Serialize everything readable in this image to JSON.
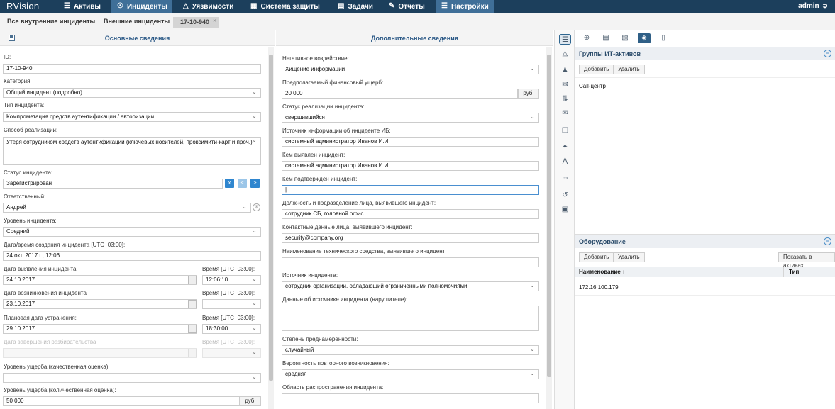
{
  "app": {
    "logo": "RVision",
    "nav": [
      "Активы",
      "Инциденты",
      "Уязвимости",
      "Система защиты",
      "Задачи",
      "Отчеты",
      "Настройки"
    ],
    "user": "admin"
  },
  "tabs": {
    "internal": "Все внутренние инциденты",
    "external": "Внешние инциденты",
    "current": "17-10-940",
    "close": "×"
  },
  "left": {
    "title": "Основные сведения",
    "id_label": "ID:",
    "id_value": "17-10-940",
    "category_label": "Категория:",
    "category_value": "Общий инцидент (подробно)",
    "type_label": "Тип инцидента:",
    "type_value": "Компрометация средств аутентификации / авторизации",
    "method_label": "Способ реализации:",
    "method_value": "Утеря сотрудником средств аутентификации (ключевых носителей, проксимити-карт и проч.)",
    "status_label": "Статус инцидента:",
    "status_value": "Зарегистрирован",
    "status_btn_x": "x",
    "status_btn_prev": "<",
    "status_btn_next": ">",
    "responsible_label": "Ответственный:",
    "responsible_value": "Андрей",
    "clear_symbol": "⊗",
    "level_label": "Уровень инцидента:",
    "level_value": "Средний",
    "created_label": "Дата/время создания инцидента [UTC+03:00]:",
    "created_value": "24 окт. 2017 г., 12:06",
    "detected_label": "Дата выявления инцидента",
    "detected_date": "24.10.2017",
    "time_label": "Время [UTC+03:00]:",
    "detected_time": "12:06:10",
    "occurred_label": "Дата возникновения инцидента",
    "occurred_date": "23.10.2017",
    "occurred_time": "",
    "planned_label": "Плановая дата устранения:",
    "planned_date": "29.10.2017",
    "planned_time": "18:30:00",
    "finished_label": "Дата завершения разбирательства",
    "damage_q_label": "Уровень ущерба (качественная оценка):",
    "damage_q_value": "",
    "damage_n_label": "Уровень ущерба (количественная оценка):",
    "damage_n_value": "50 000",
    "currency": "руб."
  },
  "mid": {
    "title": "Дополнительные сведения",
    "impact_label": "Негативное воздействие:",
    "impact_value": "Хищение информации",
    "loss_label": "Предполагаемый финансовый ущерб:",
    "loss_value": "20 000",
    "currency": "руб.",
    "impl_label": "Статус реализации инцидента:",
    "impl_value": "свершившийся",
    "src_info_label": "Источник информации об инциденте ИБ:",
    "src_info_value": "системный администратор Иванов И.И.",
    "found_by_label": "Кем выявлен инцидент:",
    "found_by_value": "системный администратор Иванов И.И.",
    "confirmed_label": "Кем подтвержден инцидент:",
    "confirmed_value": "|",
    "position_label": "Должность и подразделение лица, выявившего инцидент:",
    "position_value": "сотрудник СБ, головной офис",
    "contact_label": "Контактные данные лица, выявившего инцидент:",
    "contact_value": "security@company.org",
    "tech_label": "Наименование технического средства, выявившего инцидент:",
    "tech_value": "",
    "source_label": "Источник инцидента:",
    "source_value": "сотрудник организации, обладающий ограниченными полномочиями",
    "violator_label": "Данные об источнике инцидента (нарушителе):",
    "violator_value": "",
    "intent_label": "Степень преднамеренности:",
    "intent_value": "случайный",
    "repeat_label": "Вероятность повторного возникновения:",
    "repeat_value": "средняя",
    "area_label": "Область распространения инцидента:",
    "area_value": ""
  },
  "right": {
    "groups_title": "Группы ИТ-активов",
    "add": "Добавить",
    "remove": "Удалить",
    "group_item": "Call-центр",
    "equipment_title": "Оборудование",
    "show_in_assets": "Показать в активах",
    "col_name": "Наименование ↑",
    "col_type": "Тип",
    "equipment_item": "172.16.100.179"
  }
}
